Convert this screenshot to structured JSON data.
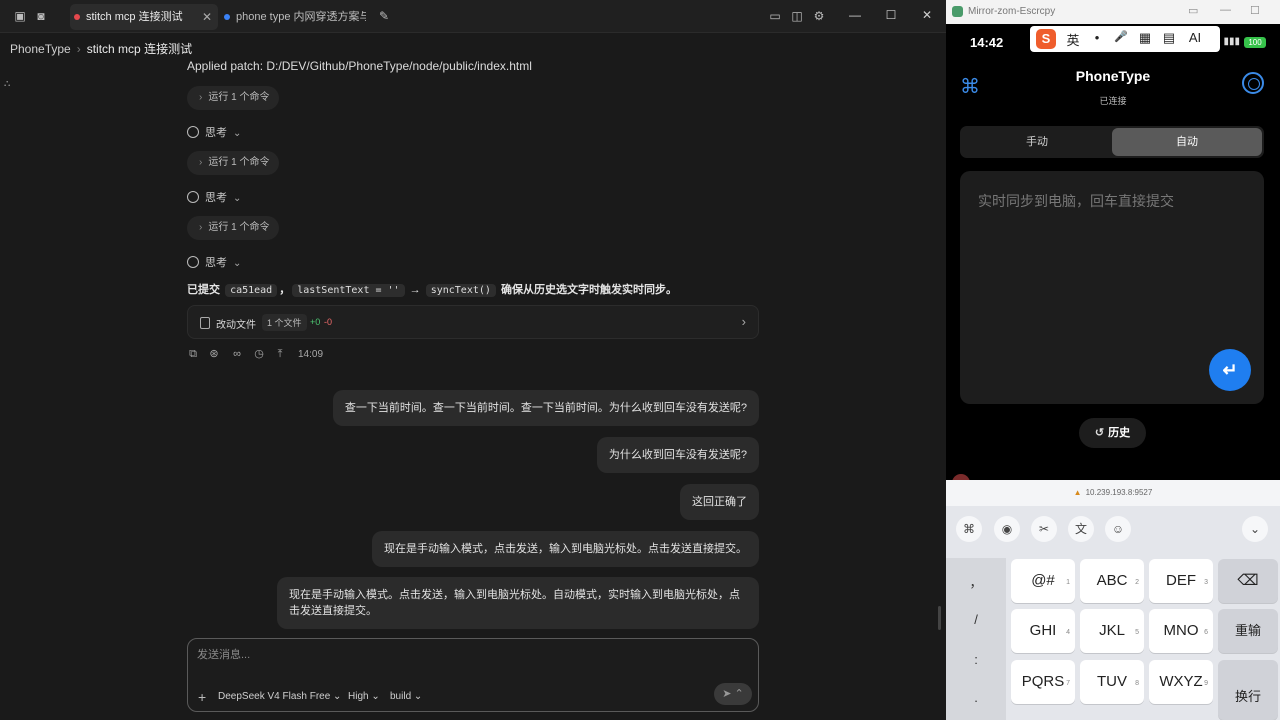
{
  "titlebar": {
    "tabs": [
      {
        "label": "stitch mcp 连接测试",
        "dot": "#e5484d"
      },
      {
        "label": "phone type 内网穿透方案与2",
        "dot": "#3b82f6"
      }
    ],
    "icons": [
      "sidebar-toggle-icon",
      "screen-icon",
      "new-tab-icon",
      "terminal-icon",
      "panel-icon",
      "settings-icon"
    ]
  },
  "breadcrumb": {
    "root": "PhoneType",
    "current": "stitch mcp 连接测试"
  },
  "chat": {
    "applied_patch": "Applied patch: D:/DEV/Github/PhoneType/node/public/index.html",
    "run_command": "运行 1 个命令",
    "think": "思考",
    "summary": {
      "prefix": "已提交",
      "code1": "ca51ead",
      "sep": "，",
      "code2": "lastSentText = ''",
      "arrow": "→",
      "code3": "syncText()",
      "suffix": "确保从历史选文字时触发实时同步。"
    },
    "changed_files": {
      "label": "改动文件",
      "count": "1 个文件",
      "added": "+0",
      "removed": "-0"
    },
    "time": "14:09",
    "messages": [
      "查一下当前时间。查一下当前时间。查一下当前时间。为什么收到回车没有发送呢?",
      "为什么收到回车没有发送呢?",
      "这回正确了",
      "现在是手动输入模式，点击发送，输入到电脑光标处。点击发送直接提交。",
      "现在是手动输入模式。点击发送，输入到电脑光标处。自动模式，实时输入到电脑光标处，点击发送直接提交。"
    ]
  },
  "composer": {
    "placeholder": "发送消息...",
    "model": "DeepSeek V4 Flash Free",
    "effort": "High",
    "mode": "build"
  },
  "mirror": {
    "window_title": "Mirror-zom-Escrcpy",
    "status_time": "14:42",
    "battery": "100",
    "ime_keys": [
      "英",
      "•",
      "🎤",
      "▦",
      "▤",
      "AI"
    ],
    "app_title": "PhoneType",
    "app_status": "已连接",
    "mode_manual": "手动",
    "mode_auto": "自动",
    "input_placeholder": "实时同步到电脑，回车直接提交",
    "history": "历史",
    "ip": "10.239.193.8:9527",
    "keys": [
      {
        "label": "@#",
        "n": "1"
      },
      {
        "label": "ABC",
        "n": "2"
      },
      {
        "label": "DEF",
        "n": "3"
      },
      {
        "label": "GHI",
        "n": "4"
      },
      {
        "label": "JKL",
        "n": "5"
      },
      {
        "label": "MNO",
        "n": "6"
      },
      {
        "label": "PQRS",
        "n": "7"
      },
      {
        "label": "TUV",
        "n": "8"
      },
      {
        "label": "WXYZ",
        "n": "9"
      }
    ],
    "side_keys": [
      "，",
      "/",
      ":",
      "."
    ],
    "reenter": "重输",
    "newline": "换行"
  }
}
